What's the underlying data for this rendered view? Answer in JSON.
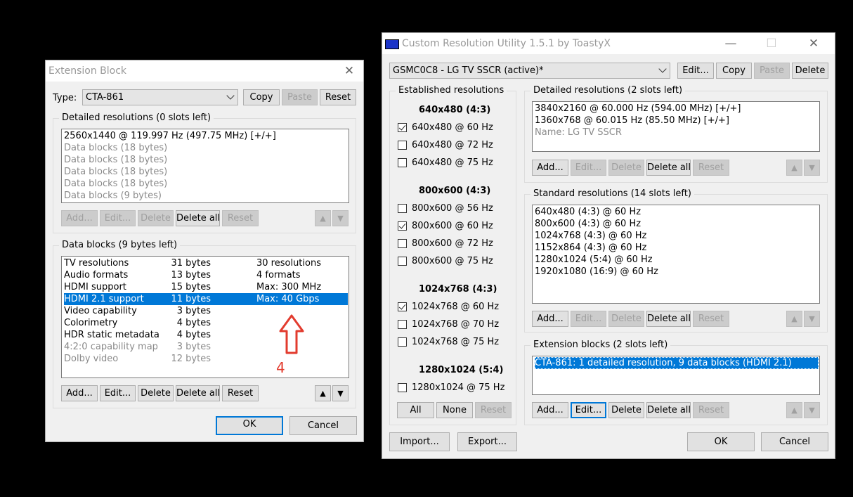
{
  "ext": {
    "title": "Extension Block",
    "type_label": "Type:",
    "type_value": "CTA-861",
    "copy": "Copy",
    "paste": "Paste",
    "reset": "Reset",
    "detailed_title": "Detailed resolutions (0 slots left)",
    "detailed_items": [
      "2560x1440 @ 119.997 Hz (497.75 MHz) [+/+]",
      "Data blocks (18 bytes)",
      "Data blocks (18 bytes)",
      "Data blocks (18 bytes)",
      "Data blocks (18 bytes)",
      "Data blocks (9 bytes)"
    ],
    "datablocks_title": "Data blocks (9 bytes left)",
    "data_rows": [
      {
        "name": "TV resolutions",
        "bytes": "31 bytes",
        "info": "30 resolutions"
      },
      {
        "name": "Audio formats",
        "bytes": "13 bytes",
        "info": "4 formats"
      },
      {
        "name": "HDMI support",
        "bytes": "15 bytes",
        "info": "Max: 300 MHz"
      },
      {
        "name": "HDMI 2.1 support",
        "bytes": "11 bytes",
        "info": "Max: 40 Gbps"
      },
      {
        "name": "Video capability",
        "bytes": "3 bytes",
        "info": ""
      },
      {
        "name": "Colorimetry",
        "bytes": "4 bytes",
        "info": ""
      },
      {
        "name": "HDR static metadata",
        "bytes": "4 bytes",
        "info": ""
      },
      {
        "name": "4:2:0 capability map",
        "bytes": "3 bytes",
        "info": ""
      },
      {
        "name": "Dolby video",
        "bytes": "12 bytes",
        "info": ""
      }
    ],
    "annotation": "4",
    "add": "Add...",
    "edit": "Edit...",
    "delete": "Delete",
    "delete_all": "Delete all",
    "ok": "OK",
    "cancel": "Cancel"
  },
  "cru": {
    "title": "Custom Resolution Utility 1.5.1 by ToastyX",
    "display": "GSMC0C8 - LG TV SSCR (active)*",
    "edit": "Edit...",
    "copy": "Copy",
    "paste": "Paste",
    "delete": "Delete",
    "established_title": "Established resolutions",
    "groups": [
      {
        "header": "640x480 (4:3)",
        "items": [
          {
            "label": "640x480 @ 60 Hz",
            "checked": true
          },
          {
            "label": "640x480 @ 72 Hz",
            "checked": false
          },
          {
            "label": "640x480 @ 75 Hz",
            "checked": false
          }
        ]
      },
      {
        "header": "800x600 (4:3)",
        "items": [
          {
            "label": "800x600 @ 56 Hz",
            "checked": false
          },
          {
            "label": "800x600 @ 60 Hz",
            "checked": true
          },
          {
            "label": "800x600 @ 72 Hz",
            "checked": false
          },
          {
            "label": "800x600 @ 75 Hz",
            "checked": false
          }
        ]
      },
      {
        "header": "1024x768 (4:3)",
        "items": [
          {
            "label": "1024x768 @ 60 Hz",
            "checked": true
          },
          {
            "label": "1024x768 @ 70 Hz",
            "checked": false
          },
          {
            "label": "1024x768 @ 75 Hz",
            "checked": false
          }
        ]
      },
      {
        "header": "1280x1024 (5:4)",
        "items": [
          {
            "label": "1280x1024 @ 75 Hz",
            "checked": false
          }
        ]
      }
    ],
    "all": "All",
    "none": "None",
    "reset": "Reset",
    "detailed_title": "Detailed resolutions (2 slots left)",
    "detailed_items": [
      "3840x2160 @ 60.000 Hz (594.00 MHz) [+/+]",
      "1360x768 @ 60.015 Hz (85.50 MHz) [+/+]",
      "Name: LG TV SSCR"
    ],
    "standard_title": "Standard resolutions (14 slots left)",
    "standard_items": [
      "640x480 (4:3) @ 60 Hz",
      "800x600 (4:3) @ 60 Hz",
      "1024x768 (4:3) @ 60 Hz",
      "1152x864 (4:3) @ 60 Hz",
      "1280x1024 (5:4) @ 60 Hz",
      "1920x1080 (16:9) @ 60 Hz"
    ],
    "extension_title": "Extension blocks (2 slots left)",
    "extension_items": [
      "CTA-861: 1 detailed resolution, 9 data blocks (HDMI 2.1)"
    ],
    "add": "Add...",
    "edit_btn": "Edit...",
    "delete_btn": "Delete",
    "delete_all": "Delete all",
    "reset_btn": "Reset",
    "import": "Import...",
    "export": "Export...",
    "ok": "OK",
    "cancel": "Cancel"
  },
  "colors": {
    "selection": "#0078d7",
    "annotation": "#e23b2e"
  }
}
